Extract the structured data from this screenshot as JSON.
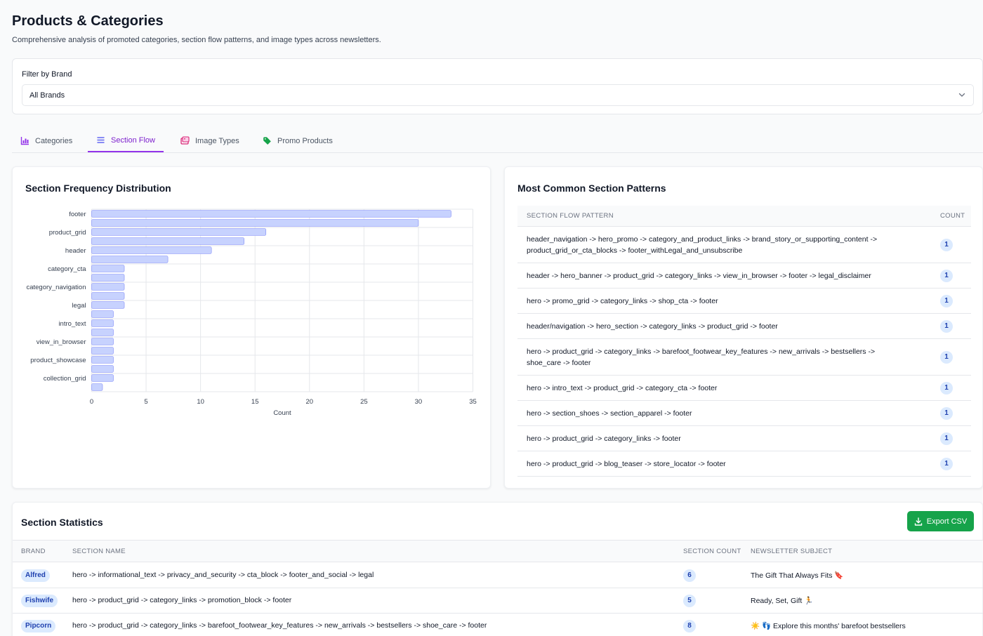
{
  "header": {
    "title": "Products & Categories",
    "subtitle": "Comprehensive analysis of promoted categories, section flow patterns, and image types across newsletters."
  },
  "filter": {
    "label": "Filter by Brand",
    "selected": "All Brands"
  },
  "tabs": [
    {
      "label": "Categories",
      "icon": "bar-chart-icon",
      "active": false
    },
    {
      "label": "Section Flow",
      "icon": "list-icon",
      "active": true
    },
    {
      "label": "Image Types",
      "icon": "images-icon",
      "active": false
    },
    {
      "label": "Promo Products",
      "icon": "tag-icon",
      "active": false
    }
  ],
  "colors": {
    "accent": "#9333ea",
    "bar_fill": "#c7d2fe",
    "bar_stroke": "#818cf8",
    "badge_bg": "#dbeafe",
    "badge_text": "#1e40af",
    "export_button": "#16a34a"
  },
  "frequency_chart": {
    "title": "Section Frequency Distribution"
  },
  "chart_data": {
    "type": "bar",
    "orientation": "horizontal",
    "title": "Section Frequency Distribution",
    "xlabel": "Count",
    "ylabel": "",
    "xlim": [
      0,
      35
    ],
    "xticks": [
      0,
      5,
      10,
      15,
      20,
      25,
      30,
      35
    ],
    "grid": true,
    "categories": [
      "footer",
      "",
      "product_grid",
      "",
      "header",
      "",
      "category_cta",
      "",
      "category_navigation",
      "",
      "legal",
      "",
      "intro_text",
      "",
      "view_in_browser",
      "",
      "product_showcase",
      "",
      "collection_grid",
      ""
    ],
    "values": [
      33,
      30,
      16,
      14,
      11,
      7,
      3,
      3,
      3,
      3,
      3,
      2,
      2,
      2,
      2,
      2,
      2,
      2,
      2,
      1
    ]
  },
  "patterns": {
    "title": "Most Common Section Patterns",
    "columns": [
      "SECTION FLOW PATTERN",
      "COUNT"
    ],
    "rows": [
      {
        "pattern": "header_navigation -> hero_promo -> category_and_product_links -> brand_story_or_supporting_content -> product_grid_or_cta_blocks -> footer_withLegal_and_unsubscribe",
        "count": "1"
      },
      {
        "pattern": "header -> hero_banner -> product_grid -> category_links -> view_in_browser -> footer -> legal_disclaimer",
        "count": "1"
      },
      {
        "pattern": "hero -> promo_grid -> category_links -> shop_cta -> footer",
        "count": "1"
      },
      {
        "pattern": "header/navigation -> hero_section -> category_links -> product_grid -> footer",
        "count": "1"
      },
      {
        "pattern": "hero -> product_grid -> category_links -> barefoot_footwear_key_features -> new_arrivals -> bestsellers -> shoe_care -> footer",
        "count": "1"
      },
      {
        "pattern": "hero -> intro_text -> product_grid -> category_cta -> footer",
        "count": "1"
      },
      {
        "pattern": "hero -> section_shoes -> section_apparel -> footer",
        "count": "1"
      },
      {
        "pattern": "hero -> product_grid -> category_links -> footer",
        "count": "1"
      },
      {
        "pattern": "hero -> product_grid -> blog_teaser -> store_locator -> footer",
        "count": "1"
      }
    ]
  },
  "statistics": {
    "title": "Section Statistics",
    "export_label": "Export CSV",
    "columns": [
      "BRAND",
      "SECTION NAME",
      "SECTION COUNT",
      "NEWSLETTER SUBJECT"
    ],
    "rows": [
      {
        "brand": "Alfred",
        "section": "hero -> informational_text -> privacy_and_security -> cta_block -> footer_and_social -> legal",
        "count": "6",
        "subject": "The Gift That Always Fits 🔖"
      },
      {
        "brand": "Fishwife",
        "section": "hero -> product_grid -> category_links -> promotion_block -> footer",
        "count": "5",
        "subject": "Ready, Set, Gift 🏃"
      },
      {
        "brand": "Pipcorn",
        "section": "hero -> product_grid -> category_links -> barefoot_footwear_key_features -> new_arrivals -> bestsellers -> shoe_care -> footer",
        "count": "8",
        "subject": "☀️ 👣 Explore this months' barefoot bestsellers"
      }
    ]
  }
}
